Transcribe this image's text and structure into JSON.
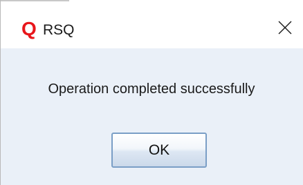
{
  "window": {
    "title": "RSQ",
    "app_icon": {
      "glyph": "Q",
      "name": "rsq-logo-icon",
      "color": "#e8161b"
    },
    "close_icon": "close-icon"
  },
  "dialog": {
    "message": "Operation completed successfully",
    "ok_label": "OK"
  },
  "colors": {
    "titlebar_bg": "#ffffff",
    "content_bg": "#eaf0f8",
    "button_border": "#7a9ec6"
  }
}
